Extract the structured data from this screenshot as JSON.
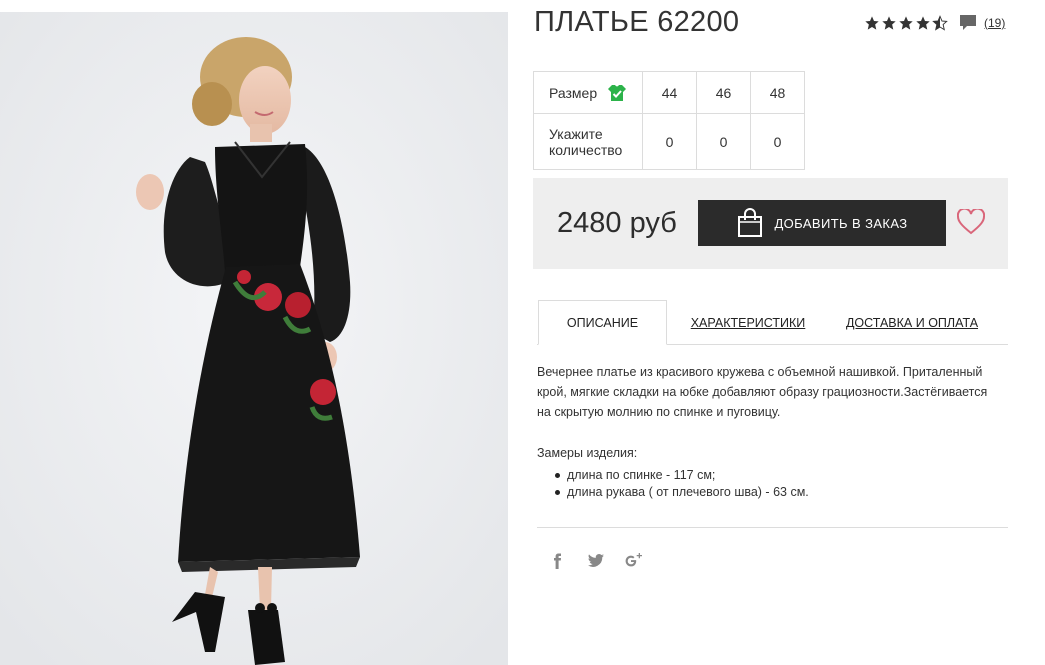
{
  "product": {
    "title": "ПЛАТЬЕ 62200",
    "rating_value": 4.5,
    "rating_max": 5,
    "review_count": "(19)"
  },
  "sizes": {
    "size_label": "Размер",
    "qty_label_line1": "Укажите",
    "qty_label_line2": "количество",
    "options": [
      "44",
      "46",
      "48"
    ],
    "quantities": [
      "0",
      "0",
      "0"
    ]
  },
  "buy": {
    "price": "2480 руб",
    "add_button": "Добавить в заказ"
  },
  "tabs": [
    {
      "label": "Описание",
      "active": true
    },
    {
      "label": "Характеристики",
      "active": false
    },
    {
      "label": "Доставка и оплата",
      "active": false
    }
  ],
  "description": {
    "text": "Вечернее платье из красивого кружева с объемной нашивкой. Приталенный крой, мягкие складки на юбке добавляют образу грациозности.Застёгивается на скрытую молнию по спинке и пуговицу.",
    "measure_title": "Замеры изделия:",
    "measures": [
      "длина по спинке - 117 см;",
      "длина рукава ( от плечевого шва) - 63 см."
    ]
  },
  "social": [
    "facebook-icon",
    "twitter-icon",
    "google-plus-icon"
  ],
  "colors": {
    "button_bg": "#2b2b2b",
    "heart": "#d9667a",
    "size_check": "#2cb34a",
    "buybox_bg": "#eeeeee"
  }
}
